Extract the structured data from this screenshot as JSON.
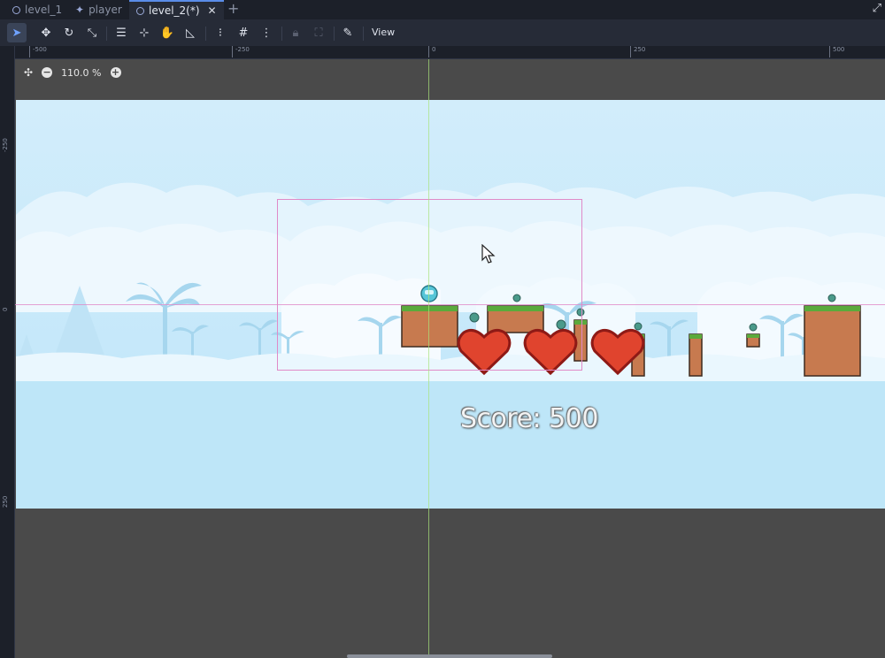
{
  "tabs": [
    {
      "label": "level_1",
      "icon": "scene-icon"
    },
    {
      "label": "player",
      "icon": "character-icon"
    },
    {
      "label": "level_2(*)",
      "icon": "scene-icon",
      "active": true
    }
  ],
  "toolbar": {
    "tools": [
      "select-tool-icon",
      "move-tool-icon",
      "rotate-tool-icon",
      "scale-tool-icon",
      "list-select-icon",
      "pivot-icon",
      "pan-tool-icon",
      "ruler-tool-icon",
      "smart-snap-icon",
      "grid-snap-icon",
      "snap-options-icon",
      "lock-icon",
      "group-icon",
      "bones-icon"
    ],
    "view_label": "View"
  },
  "ruler": {
    "top_labels": [
      "-500",
      "-250",
      "0",
      "250",
      "500"
    ],
    "left_labels": [
      "-250",
      "0",
      "250"
    ]
  },
  "viewport": {
    "zoom": "110.0 %",
    "score_text": "Score: 500"
  },
  "colors": {
    "accent": "#6fa2ff",
    "sky_top": "#d2edfb",
    "heart_red": "#e0442e",
    "dirt": "#c77a4f",
    "grass": "#5aaa3c",
    "guide_green": "#a8e27a",
    "guide_pink": "#e08ac8"
  }
}
